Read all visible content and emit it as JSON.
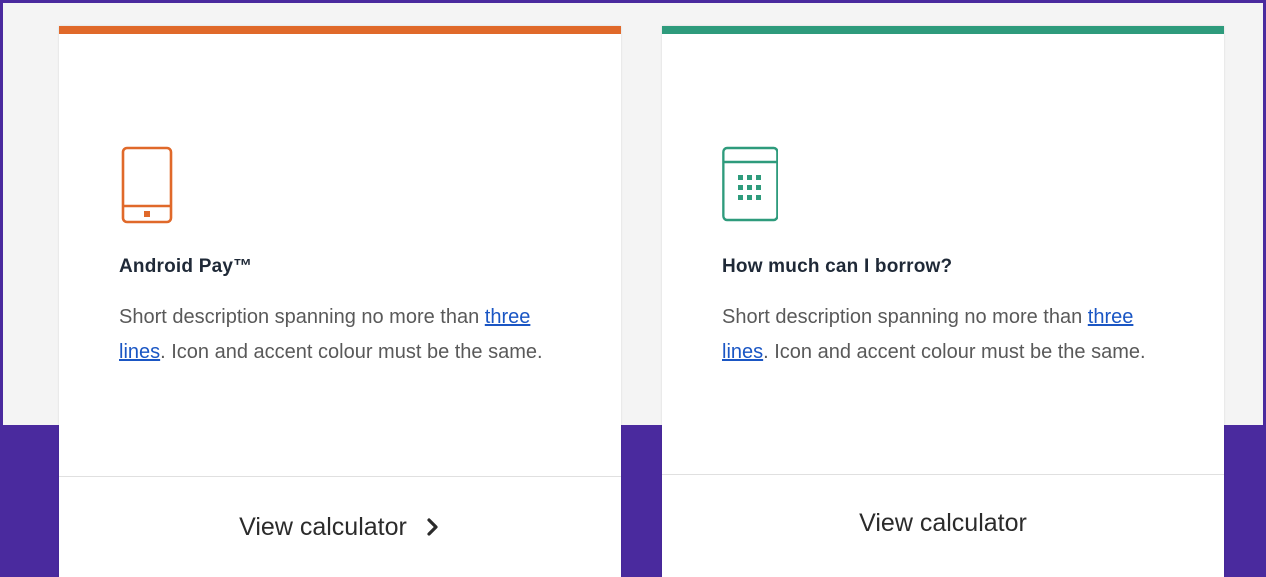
{
  "cards": [
    {
      "title": "Android Pay™",
      "desc_before": "Short description spanning no more than ",
      "desc_link": "three lines",
      "desc_after": ". Icon and accent colour must be the same.",
      "action_label": "View calculator",
      "accent_color": "#e0692a",
      "icon": "tablet-icon",
      "has_chevron": true
    },
    {
      "title": "How much can I borrow?",
      "desc_before": "Short description spanning no more than ",
      "desc_link": "three lines",
      "desc_after": ". Icon and accent colour must be the same.",
      "action_label": "View calculator",
      "accent_color": "#2e9b7c",
      "icon": "calculator-icon",
      "has_chevron": false
    }
  ]
}
